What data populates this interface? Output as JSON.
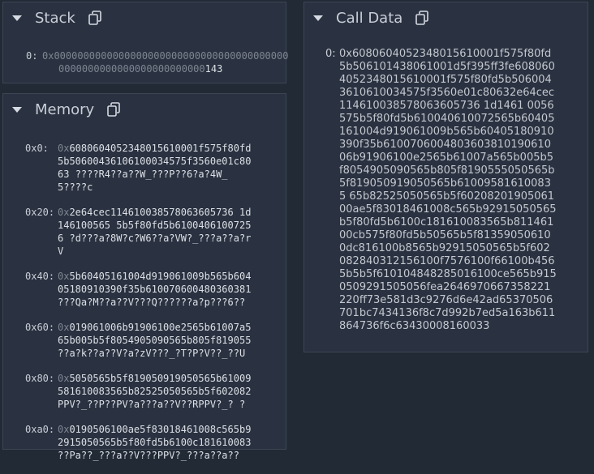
{
  "stack": {
    "title": "Stack",
    "entries": [
      {
        "index": "0:",
        "prefix": "0x",
        "zeros_line1": "0000000000000000000000000000000000000000",
        "zeros_line2": "0000000000000000000000000",
        "value": "143"
      }
    ]
  },
  "memory": {
    "title": "Memory",
    "rows": [
      {
        "addr": "0x0:",
        "prefix": "0x",
        "hex": "6080604052348015610001f575f80fd5b50600436106100034575f3560e01c8063",
        "ascii": "????R4??a??W_???P??6?a?4W_5????c"
      },
      {
        "addr": "0x20:",
        "prefix": "0x",
        "hex": "2e64cec114610038578063605736 1d146100565 5b5f80fd5b61004061007256",
        "ascii": "?d???a?8W?c?W6??a?VW?_???a??a?rV"
      },
      {
        "addr": "0x40:",
        "prefix": "0x",
        "hex": "5b60405161004d919061009b565b60405180910390f35b610070600480360381",
        "ascii": "???Qa?M??a??V???Q??????a?p???6??"
      },
      {
        "addr": "0x60:",
        "prefix": "0x",
        "hex": "019061006b91906100e2565b61007a565b005b5f8054905090565b805f819055",
        "ascii": "??a?k??a??V?a?zV???_?T?P?V??_??U"
      },
      {
        "addr": "0x80:",
        "prefix": "0x",
        "hex": "5050565b5f819050919050565b61009581610083565b82525050565b5f602082",
        "ascii": "PPV?_??P??PV?a???a??V??RPPV?_? ?"
      },
      {
        "addr": "0xa0:",
        "prefix": "0x",
        "hex": "0190506100ae5f83018461008c565b92915050565b5f80fd5b6100c181610083",
        "ascii": "??Pa??_???a??V???PPV?_???a??a??"
      }
    ]
  },
  "calldata": {
    "title": "Call Data",
    "entries": [
      {
        "index": "0:",
        "value": "0x6080604052348015610001f575f80fd5b506101438061001d5f395ff3fe6080604052348015610001f575f80fd5b5060043610610034575f3560e01c80632e64cec114610038578063605736 1d1461 0056575b5f80fd5b610040610072565b60405161004d919061009b565b60405180910390f35b610070600480360381019061006b91906100e2565b61007a565b005b5f8054905090565b805f8190555050565b5f819050919050565b610095816100835 65b82525050565b5f6020820190506100ae5f83018461008c565b92915050565b5f80fd5b6100c181610083565b811461 00cb575f80fd5b50565b5f813590506100dc816100b8565b92915050565b5f602082840312156100f7576100f66100b4565b5b5f610104848285016100ce565b9150509291505056fea2646970667358221220ff73e581d3c9276d6e42ad65370506701bc7434136f8c7d992b7ed5a163b611864736f6c63430008160033"
      }
    ]
  },
  "colors": {
    "background": "#222a36",
    "panel": "#2a3140",
    "border": "#3d4554",
    "text": "#c8ccd4"
  },
  "icons": [
    "caret-down-icon",
    "copy-icon"
  ]
}
